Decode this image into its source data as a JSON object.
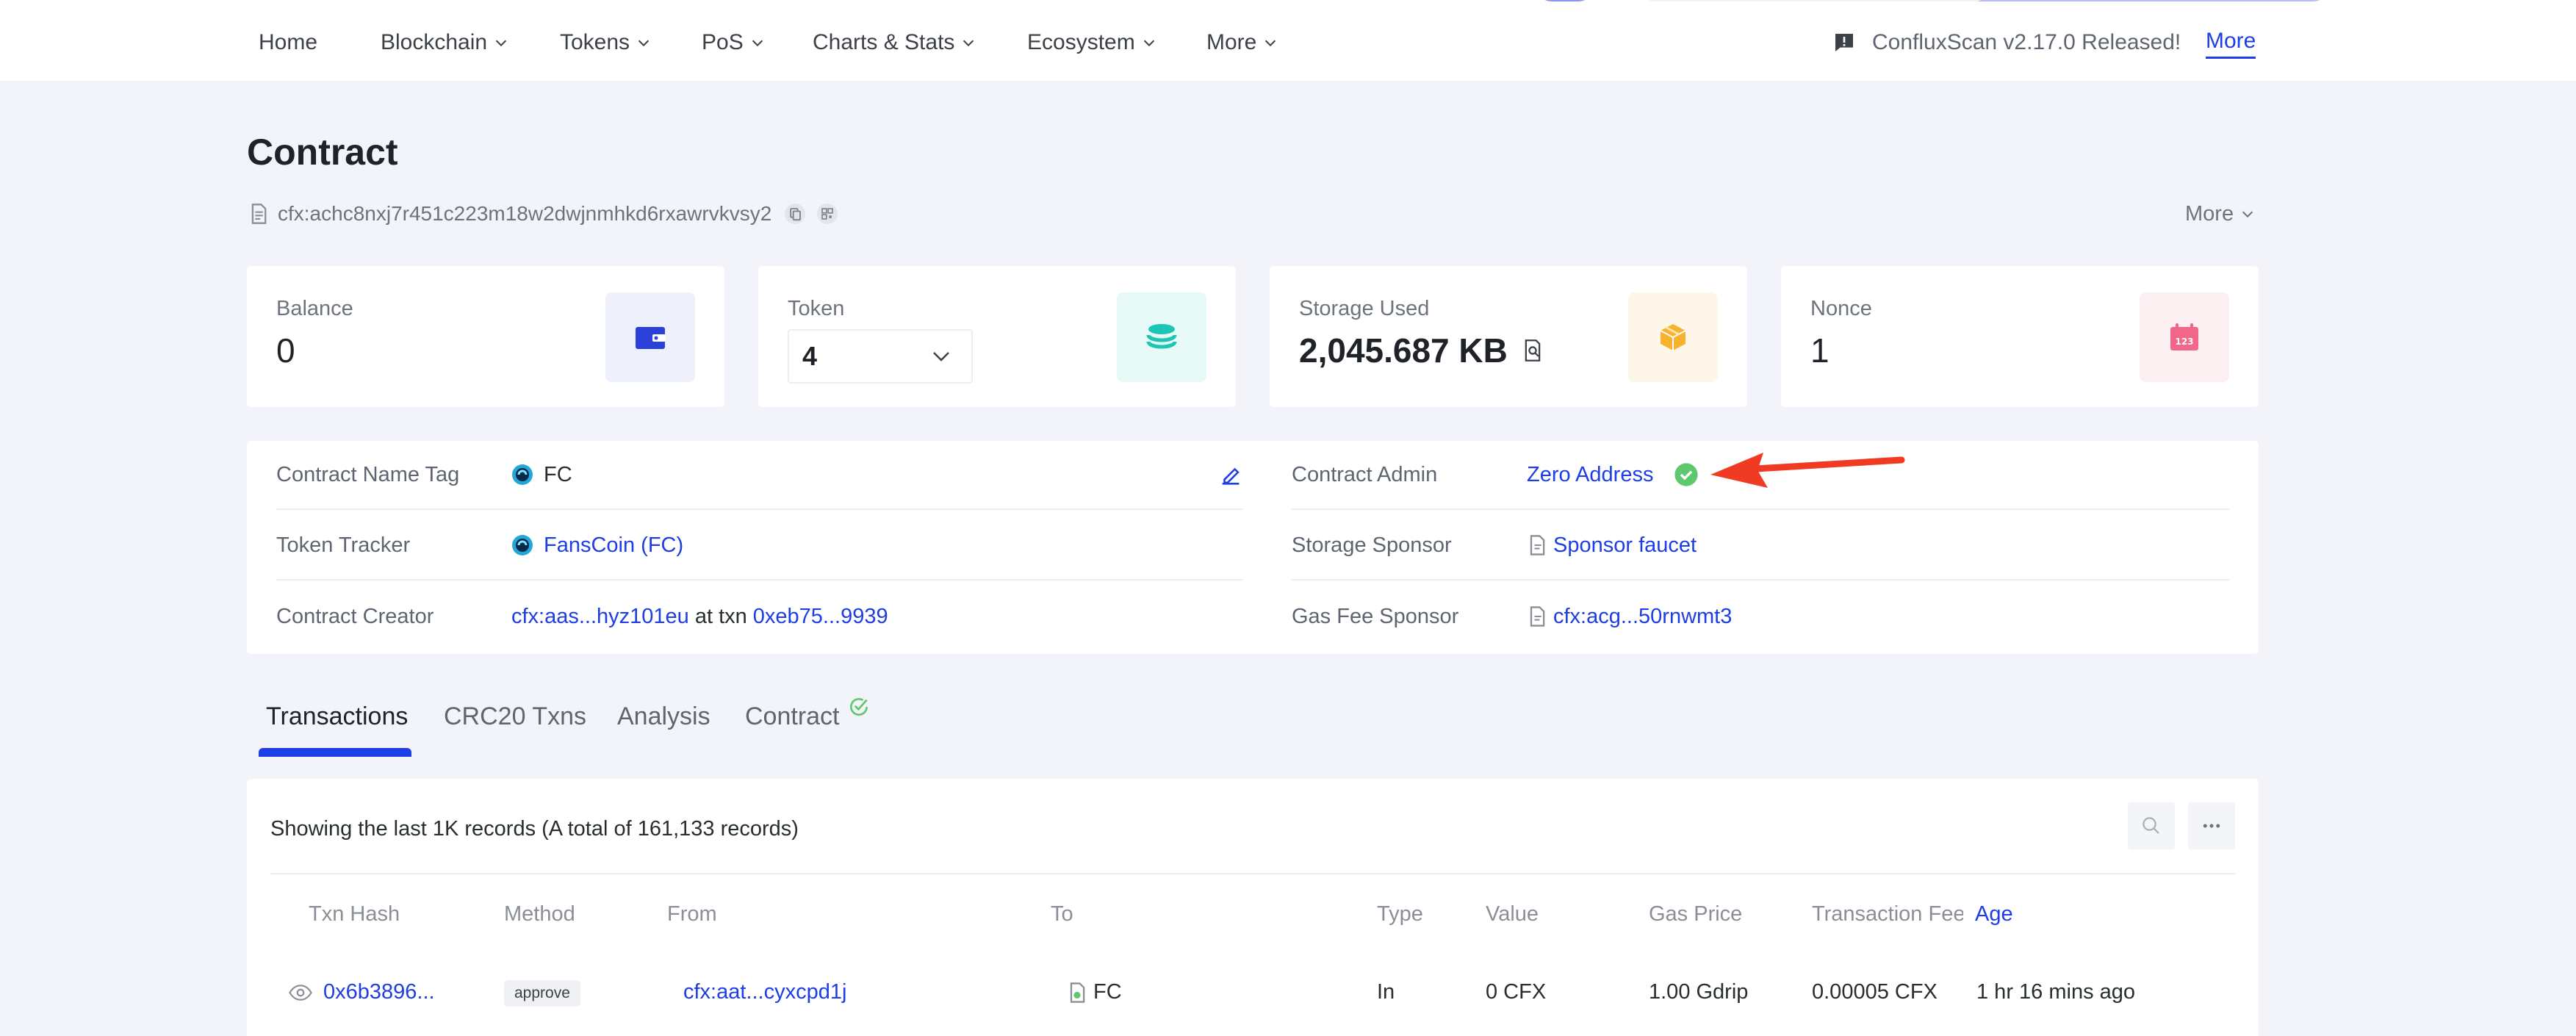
{
  "nav": {
    "items": [
      {
        "label": "Home",
        "dropdown": false
      },
      {
        "label": "Blockchain",
        "dropdown": true
      },
      {
        "label": "Tokens",
        "dropdown": true
      },
      {
        "label": "PoS",
        "dropdown": true
      },
      {
        "label": "Charts & Stats",
        "dropdown": true
      },
      {
        "label": "Ecosystem",
        "dropdown": true
      },
      {
        "label": "More",
        "dropdown": true
      }
    ],
    "announcement": "ConfluxScan v2.17.0 Released!",
    "announcement_more": "More"
  },
  "page": {
    "title": "Contract",
    "address": "cfx:achc8nxj7r451c223m18w2dwjnmhkd6rxawrvkvsy2",
    "more_label": "More"
  },
  "stats": {
    "balance": {
      "label": "Balance",
      "value": "0"
    },
    "token": {
      "label": "Token",
      "value": "4"
    },
    "storage": {
      "label": "Storage Used",
      "value": "2,045.687 KB"
    },
    "nonce": {
      "label": "Nonce",
      "value": "1"
    }
  },
  "info": {
    "name_tag": {
      "label": "Contract Name Tag",
      "value": "FC"
    },
    "token_tracker": {
      "label": "Token Tracker",
      "value": "FansCoin (FC)"
    },
    "creator": {
      "label": "Contract Creator",
      "address": "cfx:aas...hyz101eu",
      "at_txn": "at txn",
      "txn": "0xeb75...9939"
    },
    "admin": {
      "label": "Contract Admin",
      "value": "Zero Address"
    },
    "storage_sponsor": {
      "label": "Storage Sponsor",
      "value": "Sponsor faucet"
    },
    "gas_sponsor": {
      "label": "Gas Fee Sponsor",
      "value": "cfx:acg...50rnwmt3"
    }
  },
  "tabs": [
    {
      "label": "Transactions",
      "active": true
    },
    {
      "label": "CRC20 Txns",
      "active": false
    },
    {
      "label": "Analysis",
      "active": false
    },
    {
      "label": "Contract",
      "active": false,
      "verified": true
    }
  ],
  "table": {
    "records_text": "Showing the last 1K records (A total of 161,133 records)",
    "columns": [
      "Txn Hash",
      "Method",
      "From",
      "To",
      "Type",
      "Value",
      "Gas Price",
      "Transaction Fee",
      "Age"
    ],
    "rows": [
      {
        "hash": "0x6b3896...",
        "method": "approve",
        "from": "cfx:aat...cyxcpd1j",
        "to": "FC",
        "type": "In",
        "value": "0 CFX",
        "gas_price": "1.00 Gdrip",
        "fee": "0.00005 CFX",
        "age": "1 hr 16 mins ago"
      }
    ]
  },
  "colors": {
    "accent": "#1e3de4",
    "success": "#5ec86e",
    "annotation": "#f03a22"
  }
}
